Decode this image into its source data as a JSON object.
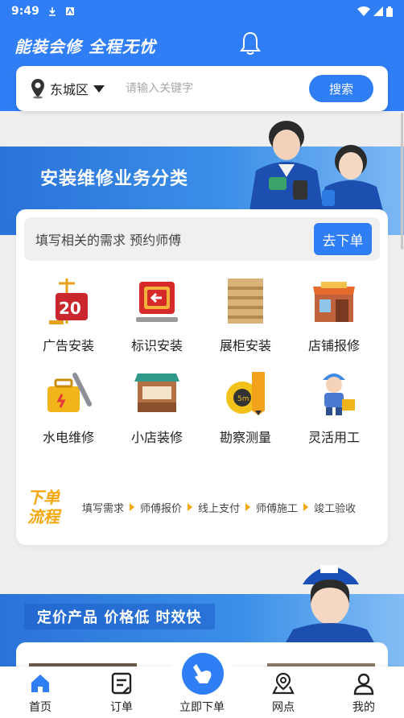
{
  "status_bar": {
    "time": "9:49"
  },
  "header": {
    "slogan": "能装会修 全程无忧"
  },
  "search": {
    "district": "东城区",
    "placeholder": "请输入关键字",
    "button": "搜索"
  },
  "banner1": {
    "title": "安装维修业务分类"
  },
  "order_bar": {
    "prompt": "填写相关的需求 预约师傅",
    "button": "去下单"
  },
  "categories": [
    {
      "label": "广告安装",
      "icon": "billboard-icon"
    },
    {
      "label": "标识安装",
      "icon": "signage-icon"
    },
    {
      "label": "展柜安装",
      "icon": "display-shelf-icon"
    },
    {
      "label": "店铺报修",
      "icon": "bakery-store-icon"
    },
    {
      "label": "水电维修",
      "icon": "toolbox-icon"
    },
    {
      "label": "小店装修",
      "icon": "kiosk-icon"
    },
    {
      "label": "勘察测量",
      "icon": "tape-measure-icon"
    },
    {
      "label": "灵活用工",
      "icon": "worker-icon"
    }
  ],
  "flow": {
    "title_line1": "下单",
    "title_line2": "流程",
    "steps": [
      "填写需求",
      "师傅报价",
      "线上支付",
      "师傅施工",
      "竣工验收"
    ]
  },
  "banner2": {
    "title": "定价产品 价格低 时效快"
  },
  "nav": {
    "home": "首页",
    "orders": "订单",
    "order_now": "立即下单",
    "outlets": "网点",
    "mine": "我的"
  },
  "colors": {
    "primary": "#2f7ef5",
    "accent": "#f4a60b"
  }
}
